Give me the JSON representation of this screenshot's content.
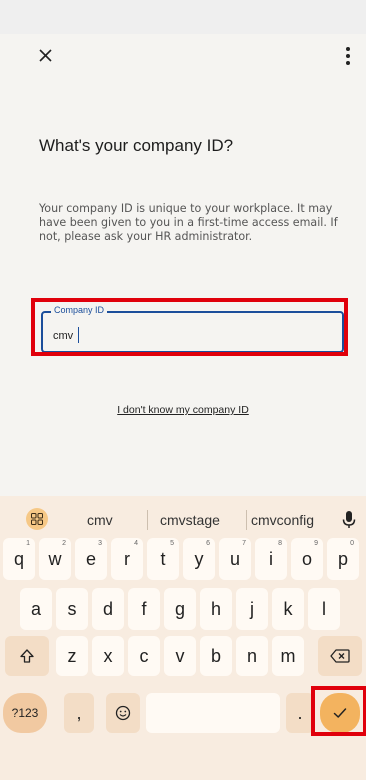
{
  "page": {
    "title": "What's your company ID?",
    "description": "Your company ID is unique to your workplace. It may have been given to you in a first-time access email. If not, please ask your HR administrator."
  },
  "field": {
    "label": "Company ID",
    "value": "cmv"
  },
  "link": {
    "label": "I don't know my company ID"
  },
  "keyboard": {
    "suggestions": [
      "cmv",
      "cmvstage",
      "cmvconfig"
    ],
    "row1": [
      {
        "k": "q",
        "n": "1"
      },
      {
        "k": "w",
        "n": "2"
      },
      {
        "k": "e",
        "n": "3"
      },
      {
        "k": "r",
        "n": "4"
      },
      {
        "k": "t",
        "n": "5"
      },
      {
        "k": "y",
        "n": "6"
      },
      {
        "k": "u",
        "n": "7"
      },
      {
        "k": "i",
        "n": "8"
      },
      {
        "k": "o",
        "n": "9"
      },
      {
        "k": "p",
        "n": "0"
      }
    ],
    "row2": [
      "a",
      "s",
      "d",
      "f",
      "g",
      "h",
      "j",
      "k",
      "l"
    ],
    "row3": [
      "z",
      "x",
      "c",
      "v",
      "b",
      "n",
      "m"
    ],
    "symbols_label": "?123",
    "comma_label": ",",
    "period_label": ".",
    "icons": {
      "close": "close-icon",
      "more": "more-vert-icon",
      "apps": "apps-grid-icon",
      "mic": "mic-icon",
      "shift": "shift-icon",
      "backspace": "backspace-icon",
      "emoji": "emoji-icon",
      "enter": "check-icon"
    },
    "colors": {
      "accent": "#1b4e9b",
      "highlight": "#e0000b",
      "enter_key": "#f3b35f"
    }
  }
}
